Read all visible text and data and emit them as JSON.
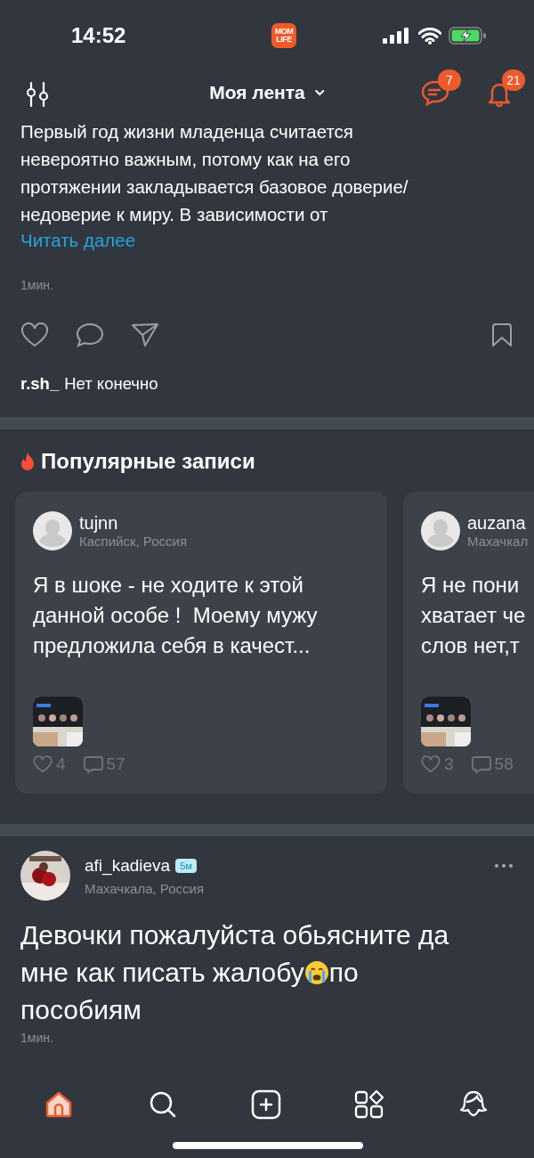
{
  "status_bar": {
    "time": "14:52",
    "logo": [
      "MOM",
      "LIFE"
    ]
  },
  "header": {
    "title": "Моя лента",
    "messages_count": "7",
    "notifications_count": "21"
  },
  "top_post": {
    "text": "Первый год жизни младенца считается невероятно важным, потому как на его протяжении закладывается базовое доверие/недоверие к миру. В зависимости от",
    "read_more": "Читать далее",
    "time": "1мин.",
    "liked": false,
    "saved": false,
    "comment": {
      "author": "r.sh_",
      "text": "Нет конечно"
    }
  },
  "popular": {
    "title": "Популярные записи",
    "cards": [
      {
        "author": "tujnn",
        "location": "Каспийск, Россия",
        "text": "Я в шоке - не ходите к этой данной особе !  Моему мужу предложила себя в качест...",
        "likes": "4",
        "comments": "57"
      },
      {
        "author": "auzana",
        "location": "Махачкал",
        "text": "Я не пони\nхватает че\nслов нет,т",
        "likes": "3",
        "comments": "58"
      }
    ]
  },
  "post": {
    "author": "afi_kadieva",
    "badge": "5м",
    "location": "Махачкала, Россия",
    "lines": [
      [
        "Девочки пожалуйста обьясните да"
      ],
      [
        "мне как писать жалобу",
        "по"
      ],
      [
        "пособиям"
      ]
    ],
    "time": "1мин."
  },
  "tab_bar": [
    {
      "kind": "home",
      "selected": true
    },
    {
      "kind": "search",
      "selected": false
    },
    {
      "kind": "add",
      "selected": false
    },
    {
      "kind": "apps",
      "selected": false
    },
    {
      "kind": "profile",
      "selected": false
    }
  ]
}
